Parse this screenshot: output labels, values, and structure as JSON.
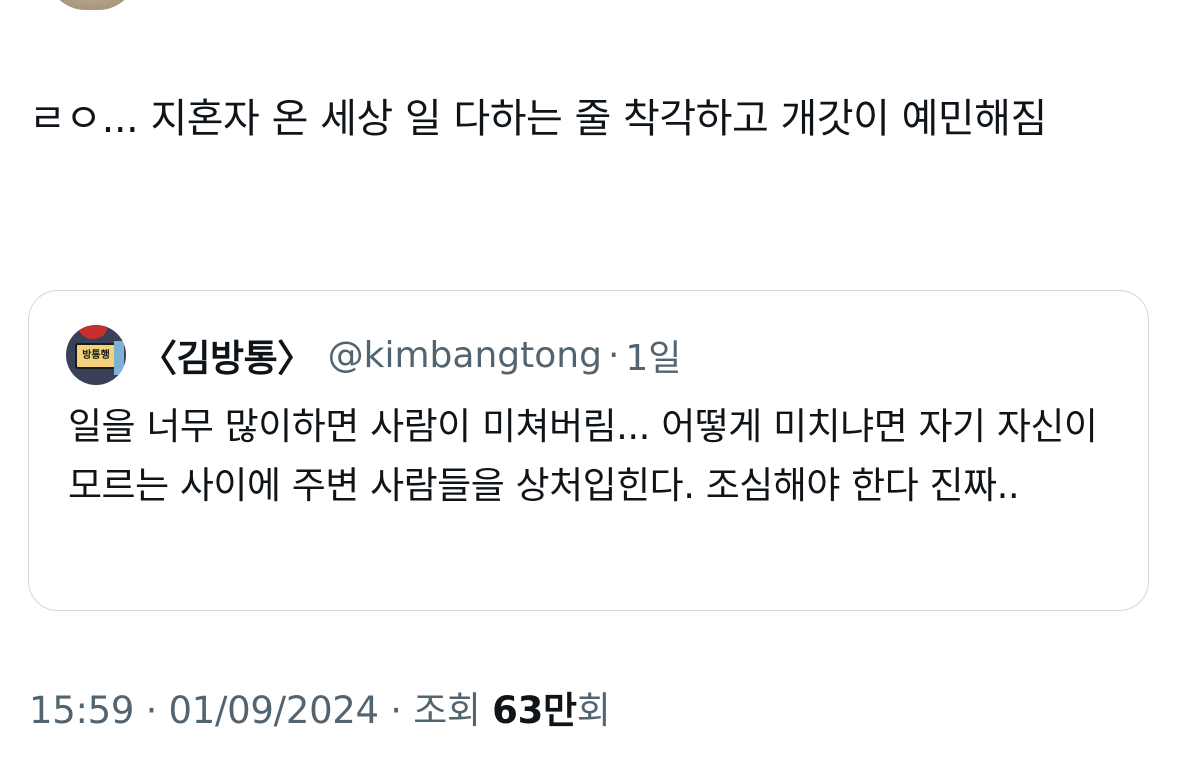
{
  "tweet": {
    "text": "ㄹㅇ... 지혼자 온 세상 일 다하는 줄 착각하고 개갓이 예민해짐"
  },
  "quote": {
    "avatar_sign": "방통행",
    "display_name": "〈김방통〉",
    "handle": "@kimbangtong",
    "separator": "·",
    "age": "1일",
    "text": "일을 너무 많이하면 사람이 미쳐버림... 어떻게 미치냐면 자기 자신이 모르는 사이에 주변 사람들을 상처입힌다. 조심해야 한다 진짜.."
  },
  "meta": {
    "time": "15:59",
    "separator1": " · ",
    "date": "01/09/2024",
    "separator2": " · ",
    "views_label": "조회 ",
    "views_count": "63만",
    "views_suffix": "회"
  },
  "colors": {
    "text": "#0f1419",
    "secondary": "#536471",
    "border": "#cfd9de"
  }
}
